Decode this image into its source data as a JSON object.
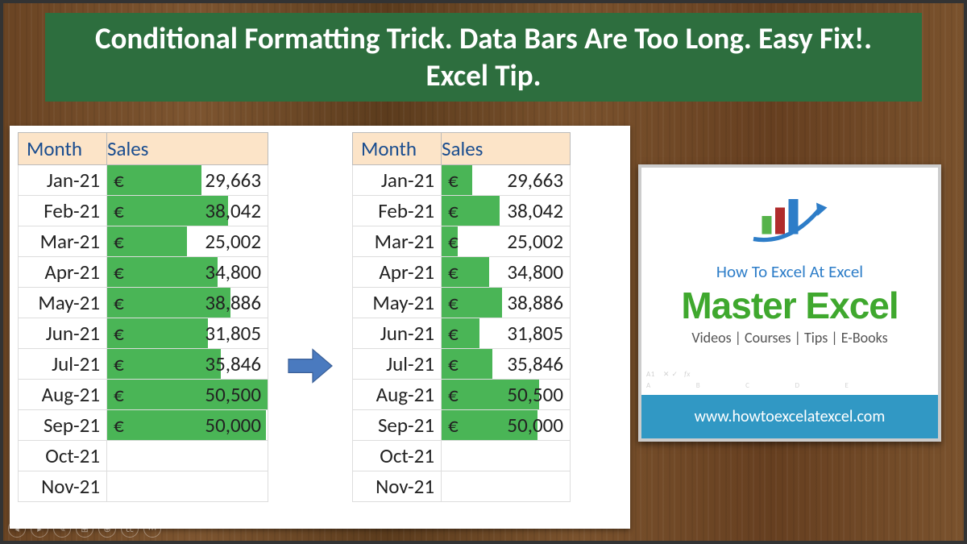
{
  "title": "Conditional Formatting Trick. Data Bars Are Too Long.  Easy Fix!. Excel Tip.",
  "headers": {
    "month": "Month",
    "sales": "Sales"
  },
  "rows": [
    {
      "m": "Jan-21",
      "cur": "€",
      "val": "29,663",
      "num": 29663
    },
    {
      "m": "Feb-21",
      "cur": "€",
      "val": "38,042",
      "num": 38042
    },
    {
      "m": "Mar-21",
      "cur": "€",
      "val": "25,002",
      "num": 25002
    },
    {
      "m": "Apr-21",
      "cur": "€",
      "val": "34,800",
      "num": 34800
    },
    {
      "m": "May-21",
      "cur": "€",
      "val": "38,886",
      "num": 38886
    },
    {
      "m": "Jun-21",
      "cur": "€",
      "val": "31,805",
      "num": 31805
    },
    {
      "m": "Jul-21",
      "cur": "€",
      "val": "35,846",
      "num": 35846
    },
    {
      "m": "Aug-21",
      "cur": "€",
      "val": "50,500",
      "num": 50500
    },
    {
      "m": "Sep-21",
      "cur": "€",
      "val": "50,000",
      "num": 50000
    },
    {
      "m": "Oct-21",
      "cur": "",
      "val": "",
      "num": null
    },
    {
      "m": "Nov-21",
      "cur": "",
      "val": "",
      "num": null
    }
  ],
  "bar_scaling": {
    "left": {
      "baseline": 0,
      "max_cap": 50500
    },
    "right": {
      "baseline": 20000,
      "max_cap": 60000
    }
  },
  "promo": {
    "sub": "How To Excel At Excel",
    "main": "Master Excel",
    "detail": "Videos | Courses | Tips | E-Books",
    "url": "www.howtoexcelatexcel.com"
  }
}
